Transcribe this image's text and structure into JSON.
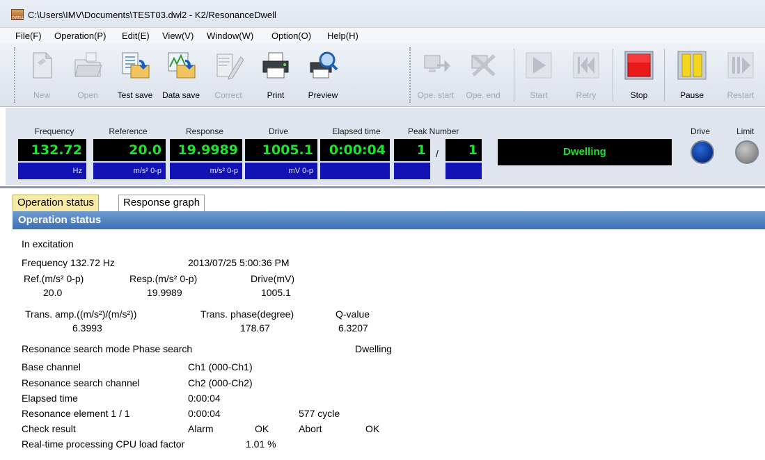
{
  "window": {
    "title": "C:\\Users\\IMV\\Documents\\TEST03.dwl2 - K2/ResonanceDwell"
  },
  "menu": [
    "File(F)",
    "Operation(P)",
    "Edit(E)",
    "View(V)",
    "Window(W)",
    "Option(O)",
    "Help(H)"
  ],
  "toolbar": {
    "new": "New",
    "open": "Open",
    "test_save": "Test save",
    "data_save": "Data save",
    "correct": "Correct",
    "print": "Print",
    "preview": "Preview",
    "ope_start": "Ope. start",
    "ope_end": "Ope. end",
    "start": "Start",
    "retry": "Retry",
    "stop": "Stop",
    "pause": "Pause",
    "restart": "Restart"
  },
  "meters": {
    "frequency": {
      "label": "Frequency",
      "value": "132.72",
      "unit": "Hz"
    },
    "reference": {
      "label": "Reference",
      "value": "20.0",
      "unit": "m/s² 0-p"
    },
    "response": {
      "label": "Response",
      "value": "19.9989",
      "unit": "m/s² 0-p"
    },
    "drive": {
      "label": "Drive",
      "value": "1005.1",
      "unit": "mV 0-p"
    },
    "elapsed": {
      "label": "Elapsed time",
      "value": "0:00:04",
      "unit": ""
    },
    "peak": {
      "label": "Peak Number",
      "value": "1",
      "total": "1",
      "sep": "/"
    },
    "state": "Dwelling",
    "lamp_drive": "Drive",
    "lamp_limit": "Limit"
  },
  "tabs": [
    "Operation status",
    "Response graph"
  ],
  "pane": {
    "header": "Operation status",
    "in_excitation": "In excitation",
    "freq": "Frequency 132.72 Hz",
    "datetime": "2013/07/25 5:00:36 PM",
    "ref_label": "Ref.(m/s² 0-p)",
    "ref_value": "20.0",
    "resp_label": "Resp.(m/s² 0-p)",
    "resp_value": "19.9989",
    "drive_label": "Drive(mV)",
    "drive_value": "1005.1",
    "trans_amp_label": "Trans. amp.((m/s²)/(m/s²))",
    "trans_amp_value": "6.3993",
    "trans_phase_label": "Trans. phase(degree)",
    "trans_phase_value": "178.67",
    "q_label": "Q-value",
    "q_value": "6.3207",
    "search_mode": "Resonance search mode  Phase search",
    "search_state": "Dwelling",
    "base_label": "Base channel",
    "base_value": "Ch1 (000-Ch1)",
    "rs_label": "Resonance search channel",
    "rs_value": "Ch2 (000-Ch2)",
    "elapsed_label": "Elapsed time",
    "elapsed_value": "0:00:04",
    "element_label": "Resonance element   1 / 1",
    "element_time": "0:00:04",
    "element_cycle": "577 cycle",
    "check_label": "Check result",
    "alarm": "Alarm",
    "alarm_ok": "OK",
    "abort": "Abort",
    "abort_ok": "OK",
    "cpu_label": "Real-time processing CPU load factor",
    "cpu_value": "1.01 %"
  }
}
